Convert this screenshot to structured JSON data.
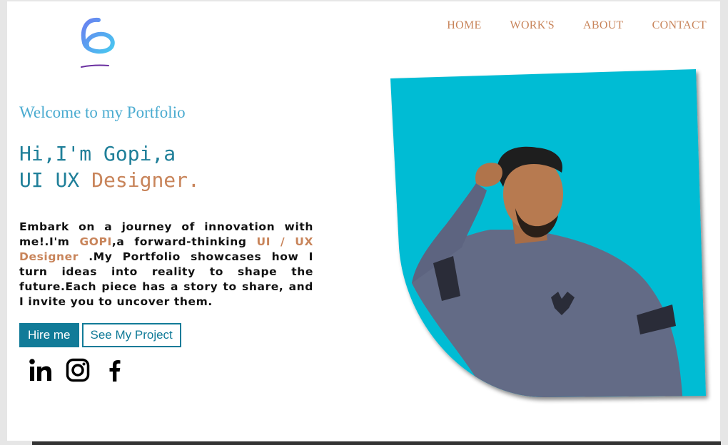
{
  "nav": {
    "items": [
      "HOME",
      "WORK'S",
      "ABOUT",
      "CONTACT"
    ]
  },
  "hero": {
    "welcome": "Welcome to my Portfolio",
    "headline_line1": "Hi,I'm Gopi,a",
    "headline_line2_prefix": "UI UX ",
    "headline_line2_accent": "Designer.",
    "bio_part1": "Embark on a journey of innovation with me!.I'm ",
    "bio_name": "GOPI",
    "bio_part2": ",a forward-thinking ",
    "bio_role": "UI / UX Designer",
    "bio_part3": " .My Portfolio showcases how I turn ideas into reality to shape the future.Each piece has a story to share, and I invite you to uncover them."
  },
  "buttons": {
    "hire": "Hire me",
    "project": "See My Project"
  },
  "socials": [
    "linkedin-icon",
    "instagram-icon",
    "facebook-icon"
  ],
  "colors": {
    "accent_orange": "#c8845a",
    "teal": "#117b98",
    "light_blue": "#4aabd0",
    "photo_bg": "#00bcd4"
  }
}
